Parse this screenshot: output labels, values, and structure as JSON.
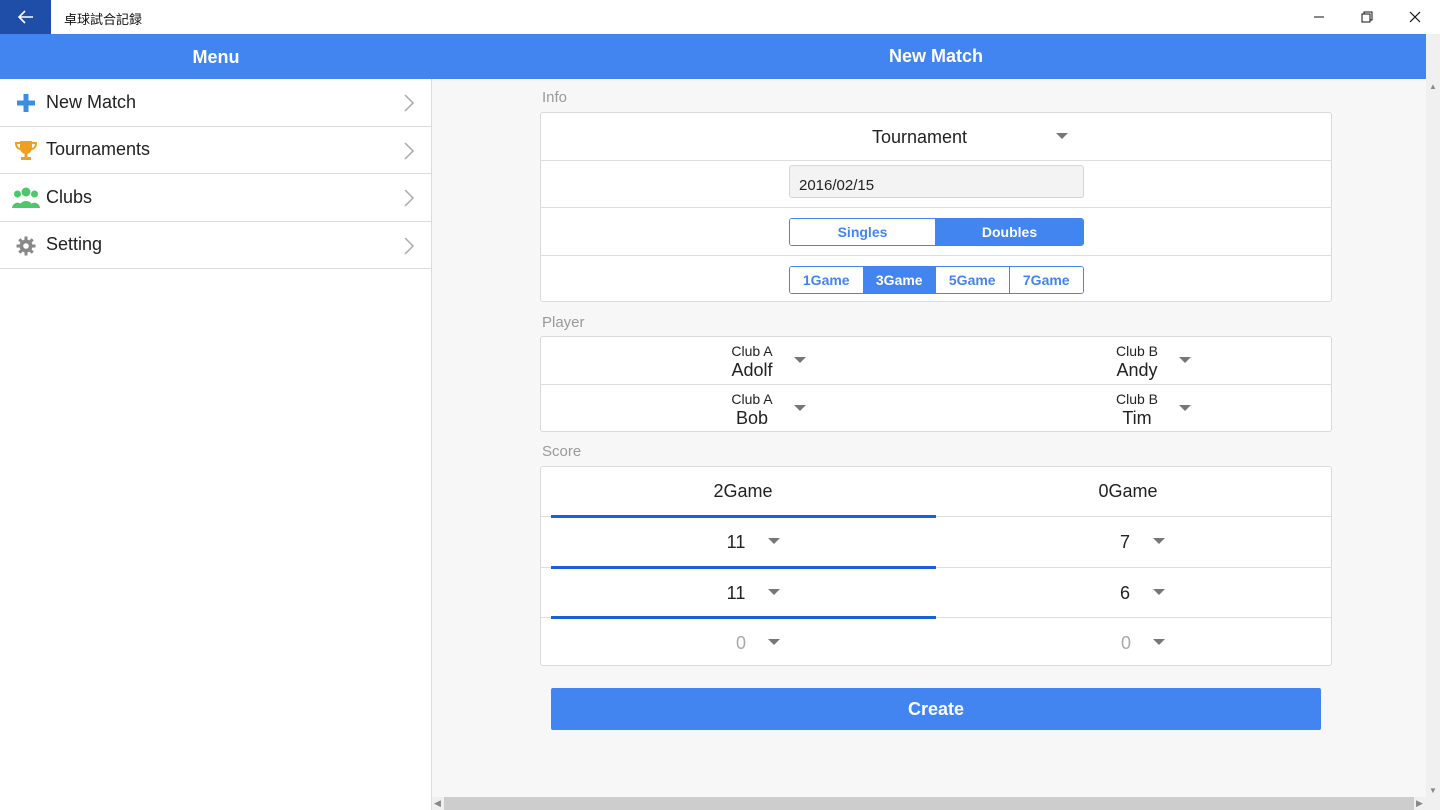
{
  "window": {
    "title": "卓球試合記録",
    "back_icon": "arrow-left-icon",
    "controls": [
      "minimize-icon",
      "restore-icon",
      "close-icon"
    ]
  },
  "header": {
    "menu_title": "Menu",
    "page_title": "New Match"
  },
  "sidebar": {
    "items": [
      {
        "label": "New Match",
        "icon": "plus-icon",
        "color": "#3b8de0"
      },
      {
        "label": "Tournaments",
        "icon": "trophy-icon",
        "color": "#f0a020"
      },
      {
        "label": "Clubs",
        "icon": "group-icon",
        "color": "#4cc86a"
      },
      {
        "label": "Setting",
        "icon": "gear-icon",
        "color": "#888888"
      }
    ]
  },
  "info": {
    "section_label": "Info",
    "tournament": "Tournament",
    "date": "2016/02/15",
    "match_type": {
      "options": [
        "Singles",
        "Doubles"
      ],
      "selected": "Doubles"
    },
    "games": {
      "options": [
        "1Game",
        "3Game",
        "5Game",
        "7Game"
      ],
      "selected": "3Game"
    }
  },
  "player": {
    "section_label": "Player",
    "rows": [
      {
        "left": {
          "club": "Club A",
          "name": "Adolf"
        },
        "right": {
          "club": "Club B",
          "name": "Andy"
        }
      },
      {
        "left": {
          "club": "Club A",
          "name": "Bob"
        },
        "right": {
          "club": "Club B",
          "name": "Tim"
        }
      }
    ]
  },
  "score": {
    "section_label": "Score",
    "left_games": "2Game",
    "right_games": "0Game",
    "rows": [
      {
        "left": "11",
        "right": "7"
      },
      {
        "left": "11",
        "right": "6"
      },
      {
        "left": "0",
        "right": "0"
      }
    ]
  },
  "actions": {
    "create_label": "Create"
  },
  "colors": {
    "accent": "#4285f0",
    "titlebar_back": "#1f4ea8",
    "underline": "#1a5fd9"
  }
}
